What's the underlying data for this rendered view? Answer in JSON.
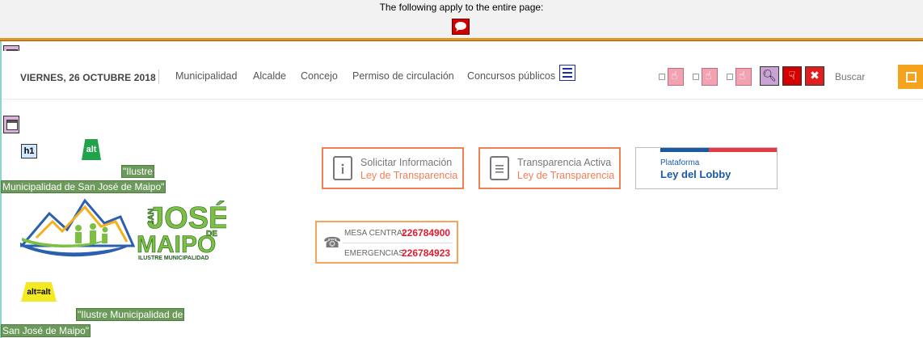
{
  "notice": {
    "text": "The following apply to the entire page:",
    "icon": "speech-bubble-icon"
  },
  "header": {
    "date": "VIERNES, 26 OCTUBRE 2018",
    "nav": [
      "Municipalidad",
      "Alcalde",
      "Concejo",
      "Permiso de circulación",
      "Concursos públicos"
    ],
    "search_placeholder": "Buscar"
  },
  "content": {
    "h1_tag": "h1",
    "alt_tag": "alt",
    "alt_text_1": [
      "\"Ilustre",
      "Municipalidad de San José de Maipo\""
    ],
    "logo": {
      "line1": "SAN",
      "line2": "JOSÉ",
      "line3": "DE",
      "line4": "MAIPO",
      "line5": "ILUSTRE MUNICIPALIDAD"
    },
    "alt_alt_tag": "alt=alt",
    "alt_text_2": [
      "\"Ilustre Municipalidad de",
      "San José de Maipo\""
    ]
  },
  "cards": [
    {
      "title": "Solicitar Información",
      "sub": "Ley de Transparencia"
    },
    {
      "title": "Transparencia Activa",
      "sub": "Ley de Transparencia"
    }
  ],
  "lobby": {
    "small": "Plataforma",
    "big": "Ley del Lobby"
  },
  "phones": [
    {
      "label": "MESA CENTRAL",
      "number": "226784900"
    },
    {
      "label": "EMERGENCIAS",
      "number": "226784923"
    }
  ],
  "colors": {
    "accent": "#f5a31c",
    "card_border": "#f27f55",
    "phone_red": "#e31b2e",
    "logo_green": "#7bc043",
    "lobby_blue": "#1a5aa5"
  }
}
